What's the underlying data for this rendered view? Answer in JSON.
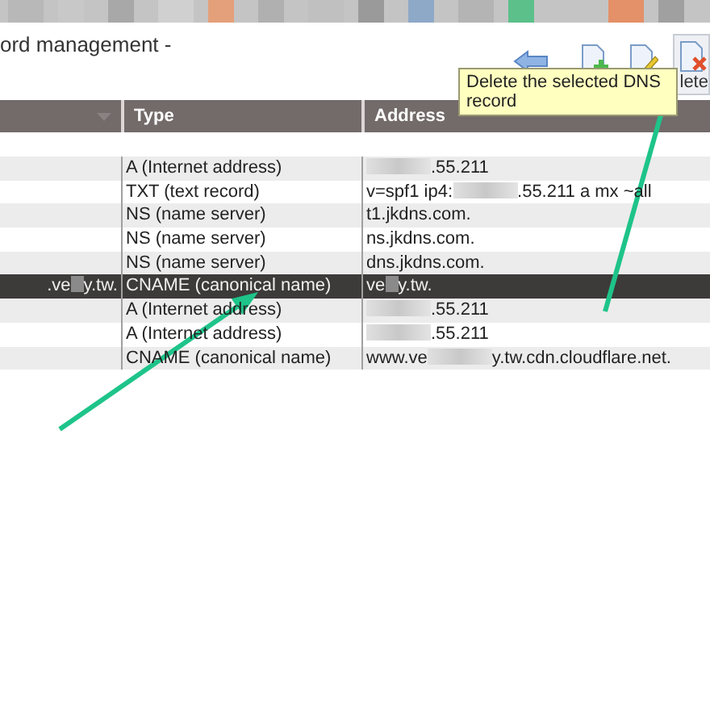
{
  "header": {
    "title": "ord management -"
  },
  "toolbar": [
    {
      "kind": "back",
      "hovered": false
    },
    {
      "kind": "add",
      "hovered": false
    },
    {
      "kind": "edit",
      "hovered": false
    },
    {
      "kind": "delete",
      "label": "lete",
      "hovered": true
    }
  ],
  "tooltip": {
    "text": "Delete the selected DNS record"
  },
  "table": {
    "columns": [
      {
        "sorted": true
      },
      {
        "label": "Type"
      },
      {
        "label": "Address"
      }
    ],
    "rows": [
      {
        "type": "A (Internet address)",
        "address": {
          "redacted": true,
          "after": ".55.211"
        },
        "selected": false
      },
      {
        "type": "TXT (text record)",
        "address": {
          "before": "v=spf1 ip4:",
          "redacted": true,
          "after": ".55.211 a mx ~all"
        },
        "selected": false
      },
      {
        "type": "NS (name server)",
        "address": "t1.jkdns.com.",
        "selected": false
      },
      {
        "type": "NS (name server)",
        "address": "ns.jkdns.com.",
        "selected": false
      },
      {
        "type": "NS (name server)",
        "address": "dns.jkdns.com.",
        "selected": false
      },
      {
        "name": {
          "before": ".ve",
          "redacted": true,
          "after": "y.tw."
        },
        "type": "CNAME (canonical name)",
        "address": {
          "before": "ve",
          "redacted": true,
          "after": "y.tw."
        },
        "selected": true
      },
      {
        "type": "A (Internet address)",
        "address": {
          "redacted": true,
          "after": ".55.211"
        },
        "selected": false
      },
      {
        "type": "A (Internet address)",
        "address": {
          "redacted": true,
          "after": ".55.211"
        },
        "selected": false
      },
      {
        "type": "CNAME (canonical name)",
        "address": {
          "before": "www.ve",
          "redacted": true,
          "after": "y.tw.cdn.cloudflare.net."
        },
        "selected": false
      }
    ]
  },
  "annotations": [
    {
      "kind": "arrow"
    },
    {
      "kind": "arrow"
    }
  ]
}
